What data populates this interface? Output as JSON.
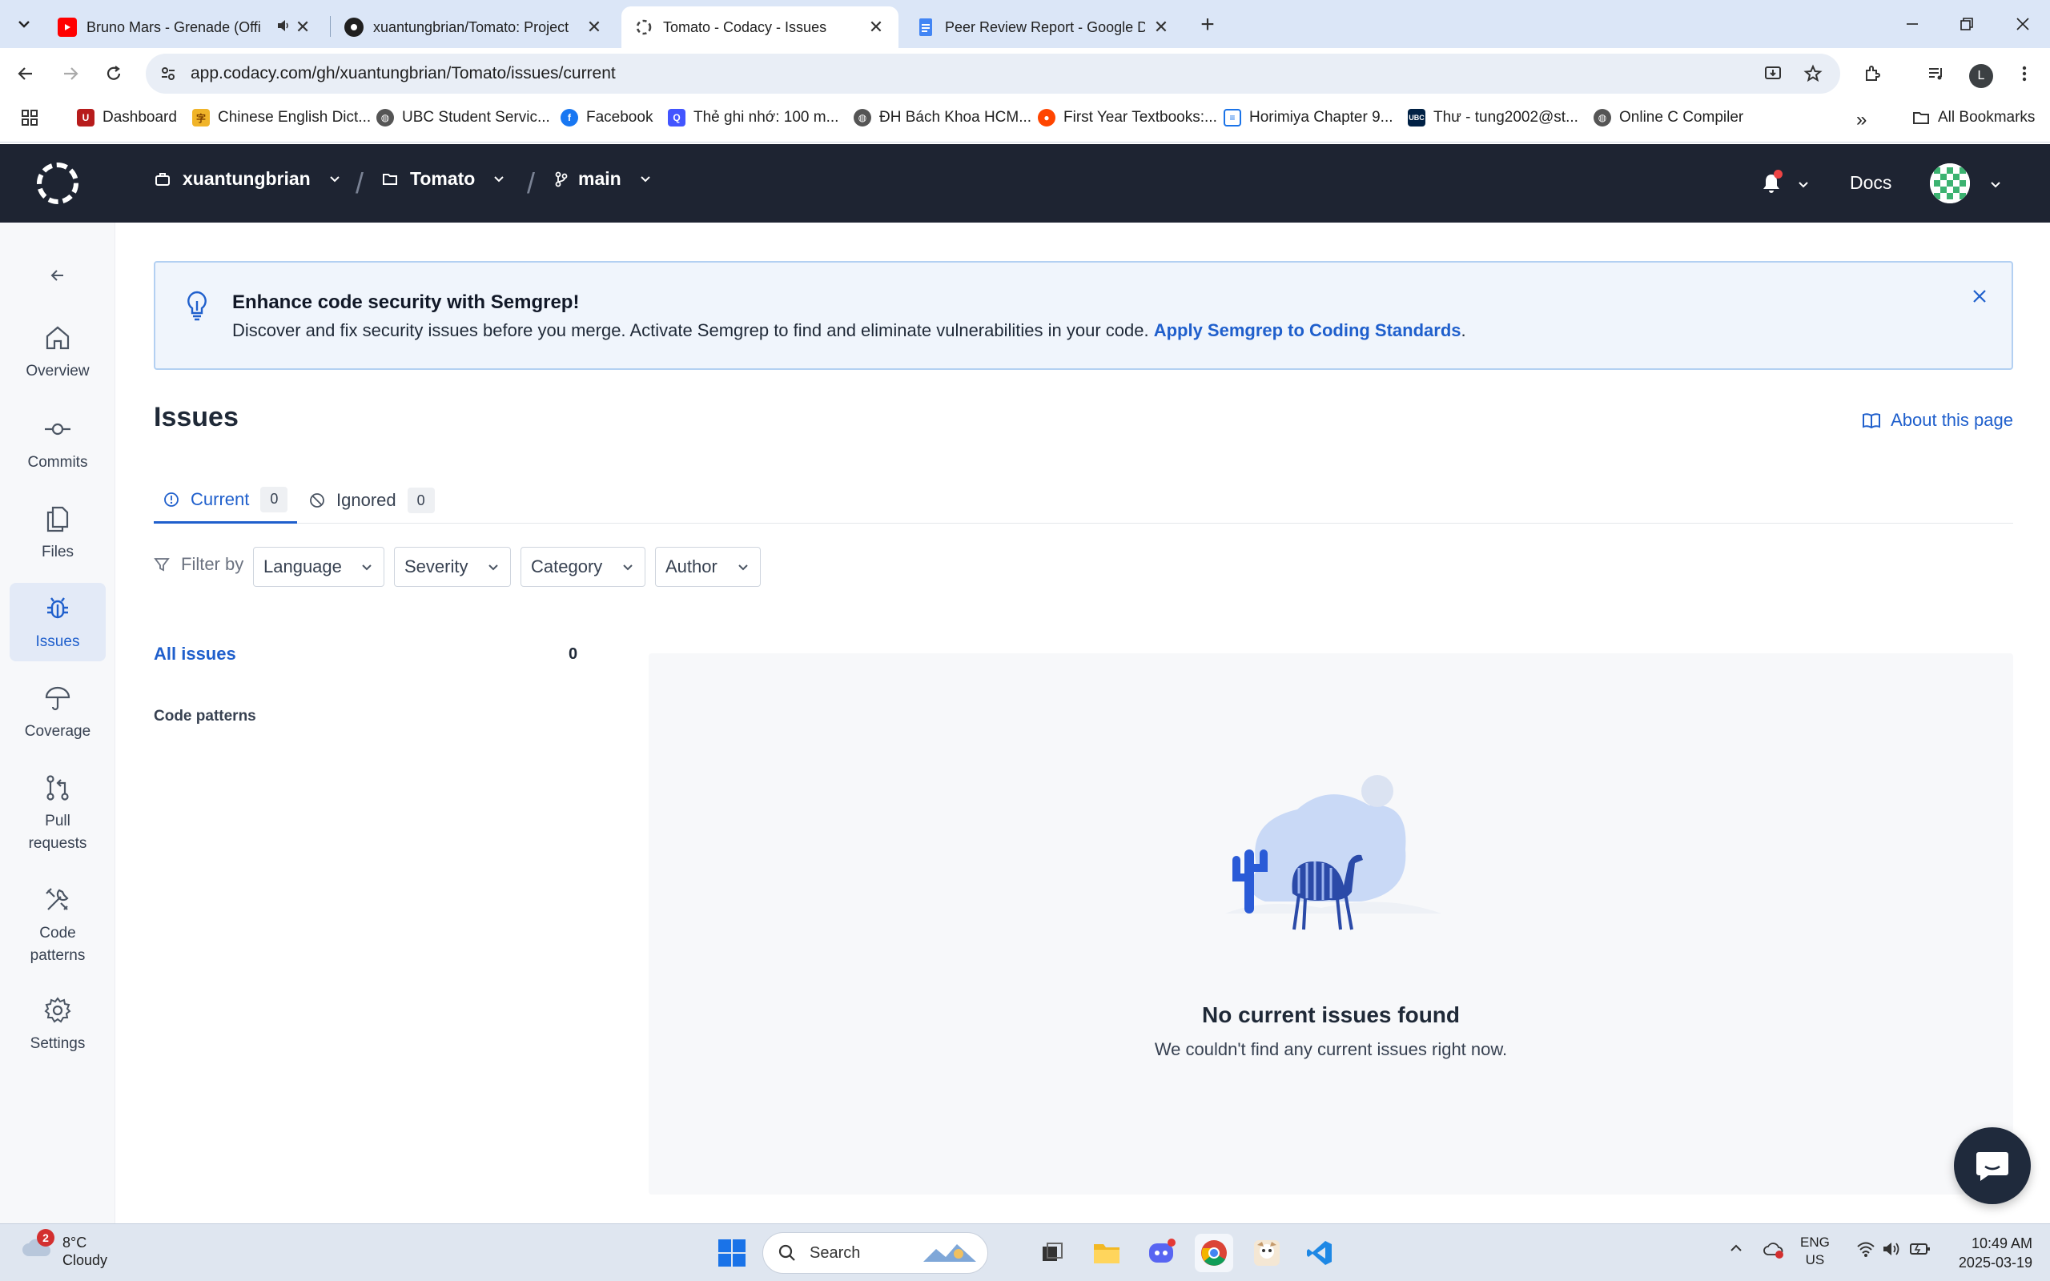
{
  "browser": {
    "tabs": [
      {
        "title": "Bruno Mars - Grenade (Offi",
        "favicon": "youtube-icon"
      },
      {
        "title": "xuantungbrian/Tomato: Project",
        "favicon": "github-icon"
      },
      {
        "title": "Tomato - Codacy - Issues",
        "favicon": "loading-icon"
      },
      {
        "title": "Peer Review Report - Google Do",
        "favicon": "google-docs-icon"
      }
    ],
    "url": "app.codacy.com/gh/xuantungbrian/Tomato/issues/current",
    "profile_initial": "L",
    "bookmarks": [
      {
        "label": "Dashboard",
        "icon": "ubc-icon"
      },
      {
        "label": "Chinese English Dict...",
        "icon": "dictionary-icon"
      },
      {
        "label": "UBC Student Servic...",
        "icon": "globe-icon"
      },
      {
        "label": "Facebook",
        "icon": "facebook-icon"
      },
      {
        "label": "Thẻ ghi nhớ: 100 m...",
        "icon": "quizlet-icon"
      },
      {
        "label": "ĐH Bách Khoa HCM...",
        "icon": "globe-icon"
      },
      {
        "label": "First Year Textbooks:...",
        "icon": "reddit-icon"
      },
      {
        "label": "Horimiya Chapter 9...",
        "icon": "doc-icon"
      },
      {
        "label": "Thư - tung2002@st...",
        "icon": "ubc-mail-icon"
      },
      {
        "label": "Online C Compiler",
        "icon": "globe-icon"
      }
    ],
    "all_bookmarks": "All Bookmarks"
  },
  "app": {
    "org": "xuantungbrian",
    "repo": "Tomato",
    "branch": "main",
    "docs": "Docs",
    "sidebar": [
      {
        "label": "Overview",
        "icon": "home-icon"
      },
      {
        "label": "Commits",
        "icon": "commit-icon"
      },
      {
        "label": "Files",
        "icon": "files-icon"
      },
      {
        "label": "Issues",
        "icon": "bug-icon"
      },
      {
        "label": "Coverage",
        "icon": "umbrella-icon"
      },
      {
        "label": "Pull requests",
        "icon": "pull-request-icon"
      },
      {
        "label": "Code patterns",
        "icon": "tools-icon"
      },
      {
        "label": "Settings",
        "icon": "gear-icon"
      }
    ],
    "banner": {
      "title": "Enhance code security with Semgrep!",
      "text": "Discover and fix security issues before you merge. Activate Semgrep to find and eliminate vulnerabilities in your code.",
      "link": "Apply Semgrep to Coding Standards",
      "link_suffix": "."
    },
    "page_title": "Issues",
    "about": "About this page",
    "tabs": [
      {
        "label": "Current",
        "count": "0"
      },
      {
        "label": "Ignored",
        "count": "0"
      }
    ],
    "filter_label": "Filter by",
    "filters": [
      "Language",
      "Severity",
      "Category",
      "Author"
    ],
    "all_issues": "All issues",
    "all_issues_count": "0",
    "code_patterns": "Code patterns",
    "empty_title": "No current issues found",
    "empty_sub": "We couldn't find any current issues right now.",
    "accent": "#1f5fcc"
  },
  "taskbar": {
    "weather_temp": "8°C",
    "weather_cond": "Cloudy",
    "weather_badge": "2",
    "search": "Search",
    "lang_1": "ENG",
    "lang_2": "US",
    "time": "10:49 AM",
    "date": "2025-03-19"
  }
}
